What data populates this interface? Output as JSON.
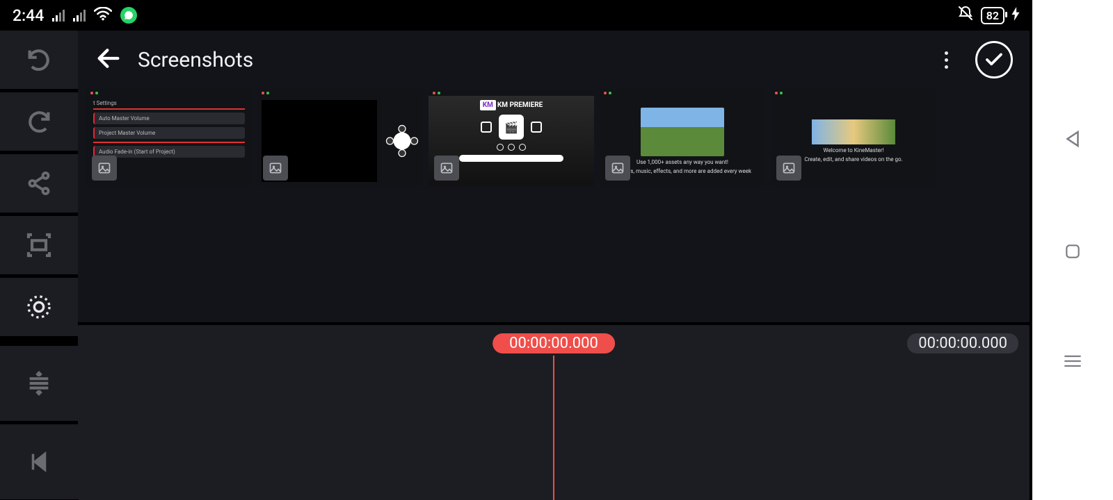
{
  "status": {
    "time": "2:44",
    "battery": "82",
    "whatsapp_icon": "whatsapp"
  },
  "header": {
    "title": "Screenshots"
  },
  "timeline": {
    "playhead": "00:00:00.000",
    "total": "00:00:00.000"
  },
  "thumbnails": [
    {
      "kind": "settings",
      "caption": "Audio Master Volume settings"
    },
    {
      "kind": "wheel",
      "caption": "Editor with action wheel"
    },
    {
      "kind": "premiere",
      "title": "KM PREMIERE"
    },
    {
      "kind": "assets",
      "title": "Use 1,000+ assets any way you want!",
      "sub": "Stickers, music, effects, and more are added every week"
    },
    {
      "kind": "welcome",
      "title": "Welcome to KineMaster!",
      "sub": "Create, edit, and share videos on the go."
    }
  ]
}
